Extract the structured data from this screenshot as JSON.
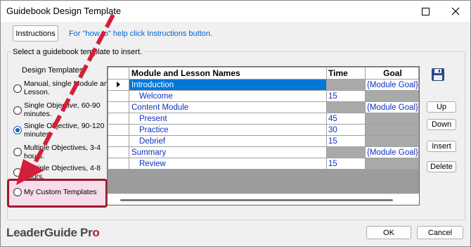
{
  "window": {
    "title": "Guidebook Design Template",
    "maximize_icon": "maximize-icon",
    "close_icon": "close-icon"
  },
  "toolbar": {
    "instructions_label": "Instructions",
    "help_link": "For \"how to\" help click Instructions button."
  },
  "prompt": "Select a guidebook template to insert.",
  "design_templates": {
    "label": "Design Templates",
    "options": [
      {
        "label": "Manual, single Module and Lesson.",
        "selected": false
      },
      {
        "label": "Single Objective, 60-90 minutes.",
        "selected": false
      },
      {
        "label": "Single Objective, 90-120 minutes.",
        "selected": true
      },
      {
        "label": "Multiple Objectives, 3-4 hours.",
        "selected": false
      },
      {
        "label": "Multiple Objectives, 4-8 hours.",
        "selected": false
      },
      {
        "label": "My Custom Templates",
        "selected": false
      }
    ]
  },
  "grid": {
    "columns": [
      "Module and Lesson Names",
      "Time",
      "Goal"
    ],
    "rows": [
      {
        "name": "Introduction",
        "time": "",
        "goal": "{Module Goal}",
        "level": "module",
        "selected": true
      },
      {
        "name": "Welcome",
        "time": "15",
        "goal": "",
        "level": "lesson"
      },
      {
        "name": "Content Module",
        "time": "",
        "goal": "{Module Goal}",
        "level": "module"
      },
      {
        "name": "Present",
        "time": "45",
        "goal": "",
        "level": "lesson"
      },
      {
        "name": "Practice",
        "time": "30",
        "goal": "",
        "level": "lesson"
      },
      {
        "name": "Debrief",
        "time": "15",
        "goal": "",
        "level": "lesson"
      },
      {
        "name": "Summary",
        "time": "",
        "goal": "{Module Goal}",
        "level": "module"
      },
      {
        "name": "Review",
        "time": "15",
        "goal": "",
        "level": "lesson"
      }
    ]
  },
  "side_buttons": {
    "save_icon": "save-icon",
    "up": "Up",
    "down": "Down",
    "insert": "Insert",
    "delete": "Delete"
  },
  "footer": {
    "logo_main": "LeaderGuide Pr",
    "logo_accent": "o",
    "ok": "OK",
    "cancel": "Cancel"
  },
  "colors": {
    "selection": "#0078d7",
    "accent_red": "#c0192b",
    "highlight_fill": "#f7dcea",
    "highlight_border": "#9c1a2a",
    "arrow": "#d41f3a"
  }
}
